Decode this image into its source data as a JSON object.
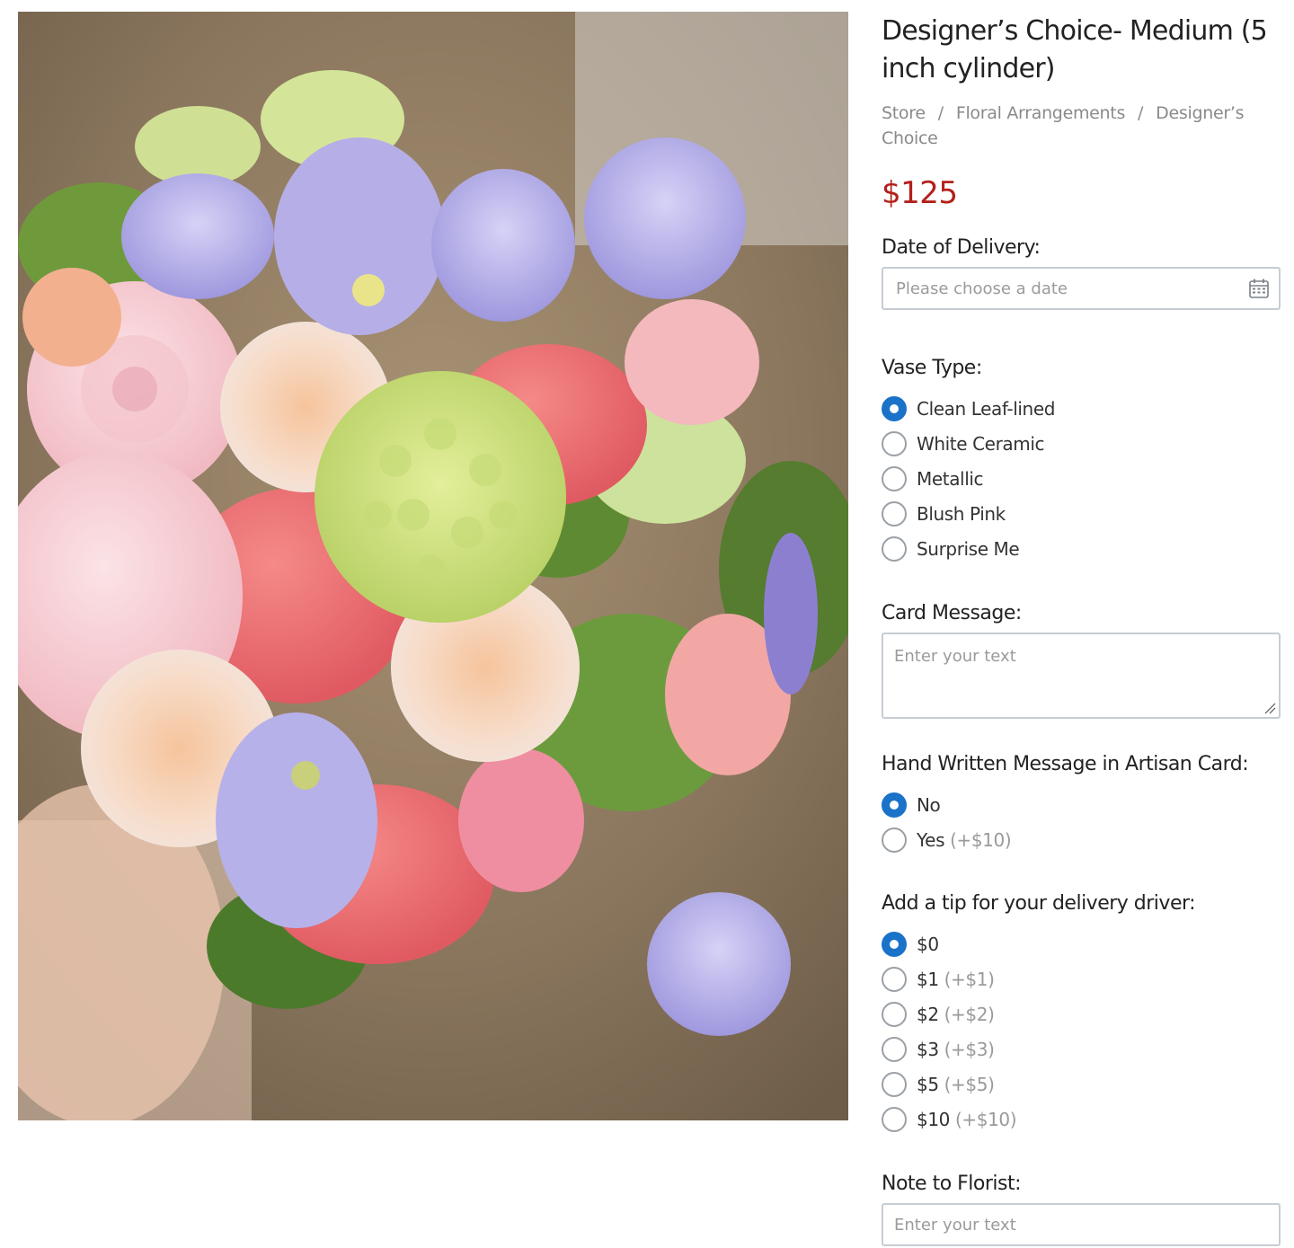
{
  "product": {
    "title": "Designer’s Choice- Medium (5 inch cylinder)",
    "price": "$125"
  },
  "breadcrumb": {
    "items": [
      "Store",
      "Floral Arrangements",
      "Designer’s Choice"
    ],
    "separator": "/"
  },
  "delivery": {
    "label": "Date of Delivery:",
    "placeholder": "Please choose a date",
    "value": "",
    "icon": "calendar-icon"
  },
  "vase": {
    "label": "Vase Type:",
    "options": [
      {
        "label": "Clean Leaf-lined",
        "checked": true
      },
      {
        "label": "White Ceramic",
        "checked": false
      },
      {
        "label": "Metallic",
        "checked": false
      },
      {
        "label": "Blush Pink",
        "checked": false
      },
      {
        "label": "Surprise Me",
        "checked": false
      }
    ]
  },
  "card_message": {
    "label": "Card Message:",
    "placeholder": "Enter your text",
    "value": ""
  },
  "handwritten": {
    "label": "Hand Written Message in Artisan Card:",
    "options": [
      {
        "label": "No",
        "extra": "",
        "checked": true
      },
      {
        "label": "Yes",
        "extra": "(+$10)",
        "checked": false
      }
    ]
  },
  "tip": {
    "label": "Add a tip for your delivery driver:",
    "options": [
      {
        "label": "$0",
        "extra": "",
        "checked": true
      },
      {
        "label": "$1",
        "extra": "(+$1)",
        "checked": false
      },
      {
        "label": "$2",
        "extra": "(+$2)",
        "checked": false
      },
      {
        "label": "$3",
        "extra": "(+$3)",
        "checked": false
      },
      {
        "label": "$5",
        "extra": "(+$5)",
        "checked": false
      },
      {
        "label": "$10",
        "extra": "(+$10)",
        "checked": false
      }
    ]
  },
  "florist_note": {
    "label": "Note to Florist:",
    "placeholder": "Enter your text",
    "value": ""
  },
  "colors": {
    "price": "#b3201b",
    "radio_checked": "#1a73c8",
    "input_border": "#c6ccd3",
    "muted_text": "#8a8a8a"
  }
}
